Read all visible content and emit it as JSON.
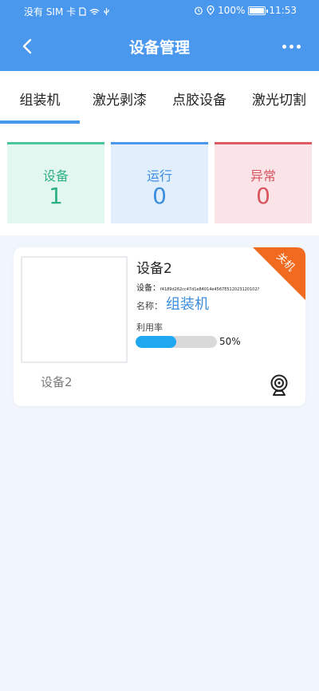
{
  "status_bar": {
    "carrier": "没有 SIM 卡",
    "battery": "100%",
    "time": "11:53"
  },
  "header": {
    "title": "设备管理"
  },
  "tabs": [
    {
      "label": "组装机",
      "active": true
    },
    {
      "label": "激光剥漆",
      "active": false
    },
    {
      "label": "点胶设备",
      "active": false
    },
    {
      "label": "激光切割",
      "active": false
    }
  ],
  "stats": [
    {
      "label": "设备",
      "value": "1",
      "color": "#2fb084"
    },
    {
      "label": "运行",
      "value": "0",
      "color": "#3d8ddf"
    },
    {
      "label": "异常",
      "value": "0",
      "color": "#d9545e"
    }
  ],
  "device": {
    "title": "设备2",
    "id_label": "设备：",
    "id_value": "f4189d262cc47d1e84014e4567E512023120102?",
    "name_label": "名称：",
    "name": "组装机",
    "utilization_label": "利用率",
    "utilization_percent": 50,
    "utilization_text": "50%",
    "status": "关机",
    "status_color": "#f26a1f",
    "thumb_label": "设备2",
    "icon": "camera-icon"
  }
}
